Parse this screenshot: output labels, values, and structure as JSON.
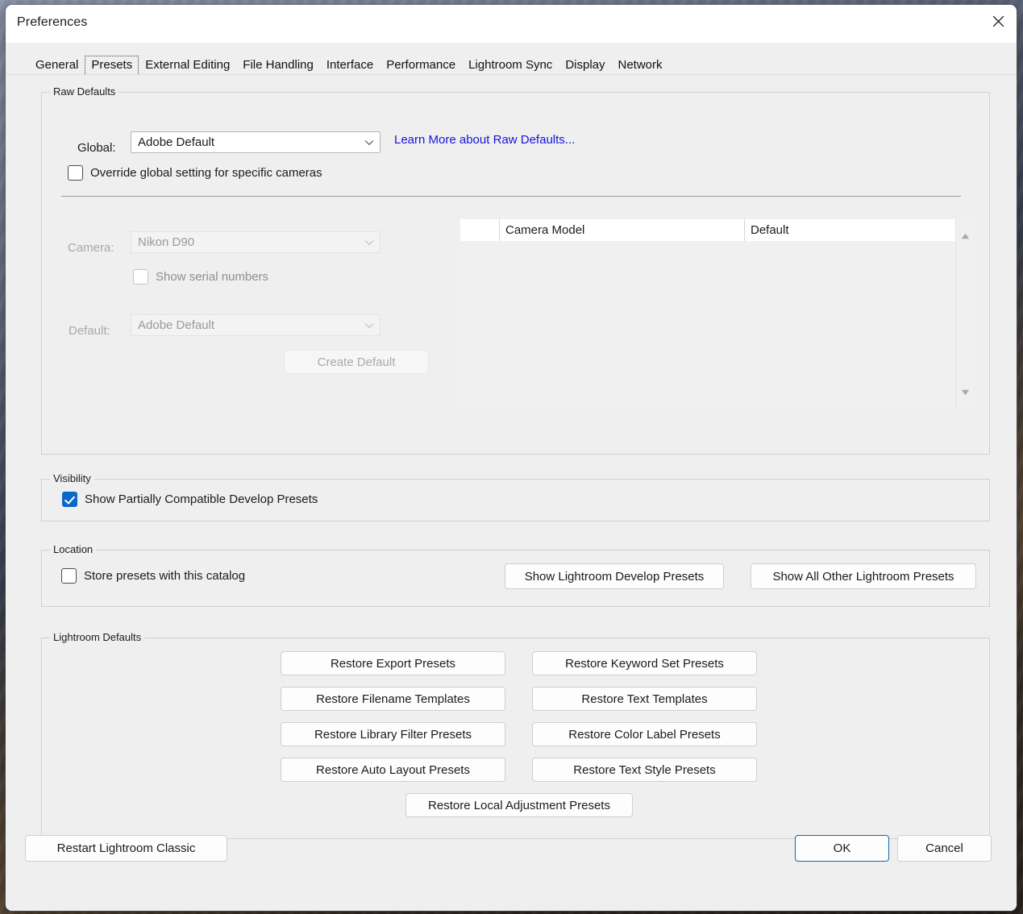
{
  "window": {
    "title": "Preferences",
    "close_icon": "close-icon"
  },
  "tabs": [
    {
      "label": "General",
      "selected": false
    },
    {
      "label": "Presets",
      "selected": true
    },
    {
      "label": "External Editing",
      "selected": false
    },
    {
      "label": "File Handling",
      "selected": false
    },
    {
      "label": "Interface",
      "selected": false
    },
    {
      "label": "Performance",
      "selected": false
    },
    {
      "label": "Lightroom Sync",
      "selected": false
    },
    {
      "label": "Display",
      "selected": false
    },
    {
      "label": "Network",
      "selected": false
    }
  ],
  "raw_defaults": {
    "legend": "Raw Defaults",
    "global_label": "Global:",
    "global_value": "Adobe Default",
    "learn_more_link": "Learn More about Raw Defaults...",
    "override_checkbox": {
      "label": "Override global setting for specific cameras",
      "checked": false
    },
    "camera_label": "Camera:",
    "camera_value": "Nikon D90",
    "show_serial_checkbox": {
      "label": "Show serial numbers",
      "checked": false
    },
    "default_label": "Default:",
    "default_value": "Adobe Default",
    "create_default_button": "Create Default",
    "table": {
      "columns": [
        "",
        "Camera Model",
        "Default"
      ],
      "rows": []
    }
  },
  "visibility": {
    "legend": "Visibility",
    "show_partially_compatible": {
      "label": "Show Partially Compatible Develop Presets",
      "checked": true
    }
  },
  "location": {
    "legend": "Location",
    "store_presets_checkbox": {
      "label": "Store presets with this catalog",
      "checked": false
    },
    "show_develop_presets_button": "Show Lightroom Develop Presets",
    "show_all_other_presets_button": "Show All Other Lightroom Presets"
  },
  "lightroom_defaults": {
    "legend": "Lightroom Defaults",
    "left_buttons": [
      "Restore Export Presets",
      "Restore Filename Templates",
      "Restore Library Filter Presets",
      "Restore Auto Layout Presets"
    ],
    "right_buttons": [
      "Restore Keyword Set Presets",
      "Restore Text Templates",
      "Restore Color Label Presets",
      "Restore Text Style Presets"
    ],
    "bottom_button": "Restore Local Adjustment Presets"
  },
  "footer": {
    "restart_button": "Restart Lightroom Classic",
    "ok_button": "OK",
    "cancel_button": "Cancel"
  },
  "colors": {
    "link": "#1414dd",
    "accent": "#0a68c7",
    "default_button_border": "#1367b8",
    "window_bg": "#efefef",
    "titlebar_bg": "#ffffff"
  }
}
